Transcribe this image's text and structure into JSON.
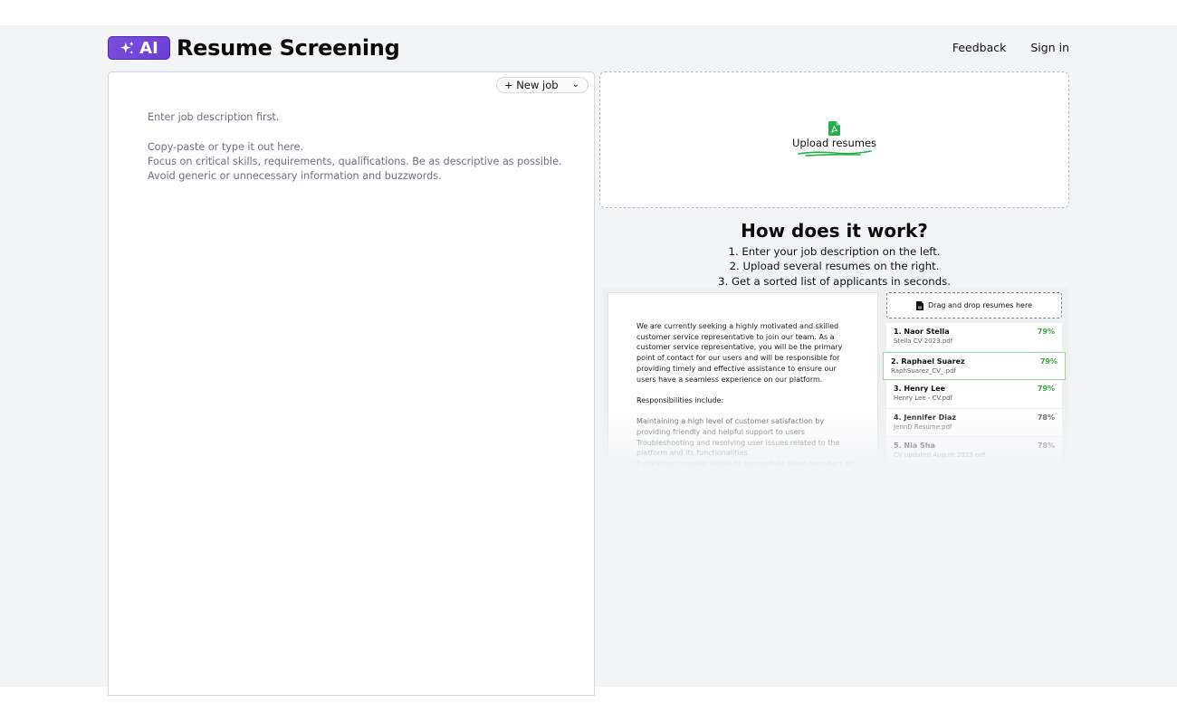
{
  "header": {
    "logo_text": "AI",
    "app_title": "Resume Screening",
    "nav": [
      {
        "label": "Feedback"
      },
      {
        "label": "Sign in"
      }
    ]
  },
  "job_panel": {
    "job_select_value": "+ New job",
    "placeholder_lines": [
      "Enter job description first.",
      "",
      "Copy-paste or type it out here.",
      "Focus on critical skills, requirements, qualifications. Be as descriptive as possible.",
      "Avoid generic or unnecessary information and buzzwords."
    ]
  },
  "upload": {
    "label": "Upload resumes"
  },
  "how_it_works": {
    "title": "How does it work?",
    "steps": [
      "1. Enter your job description on the left.",
      "2. Upload several resumes on the right.",
      "3. Get a sorted list of applicants in seconds."
    ]
  },
  "preview": {
    "doc_paragraph": "We are currently seeking a highly motivated and skilled customer service representative to join our team. As a customer service representative, you will be the primary point of contact for our users and will be responsible for providing timely and effective assistance to ensure our users have a seamless experience on our platform.",
    "doc_heading": "Responsibilities include:",
    "doc_items": [
      "Maintaining a high level of customer satisfaction by providing friendly and helpful support to users",
      "Troubleshooting and resolving user issues related to the platform and its functionalities",
      "Escalating complex issues to appropriate team members or"
    ],
    "drop_label": "Drag and drop resumes here",
    "ranked": [
      {
        "name": "1. Naor Stella",
        "file": "Stella CV 2023.pdf",
        "score": "79%",
        "green": true
      },
      {
        "name": "2. Raphael Suarez",
        "file": "RaphSuarez_CV_.pdf",
        "score": "79%",
        "green": true
      },
      {
        "name": "3. Henry Lee",
        "file": "Henry Lee - CV.pdf",
        "score": "79%",
        "green": true
      },
      {
        "name": "4. Jennifer Diaz",
        "file": "JennD Resume.pdf",
        "score": "78%",
        "green": false
      },
      {
        "name": "5. Nia Sha",
        "file": "CV updated August 2023.pdf",
        "score": "78%",
        "green": false
      }
    ]
  },
  "colors": {
    "brand_purple": "#6a3fd8",
    "upload_green": "#22b04b",
    "score_green": "#3aa33a",
    "page_bg": "#f3f4f6"
  }
}
